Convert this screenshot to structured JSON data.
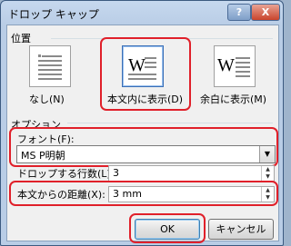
{
  "dialog": {
    "title": "ドロップ キャップ",
    "help": "?",
    "close": "X"
  },
  "position": {
    "label": "位置",
    "options": [
      {
        "caption": "なし(N)",
        "selected": false
      },
      {
        "caption": "本文内に表示(D)",
        "selected": true
      },
      {
        "caption": "余白に表示(M)",
        "selected": false
      }
    ],
    "glyph": "W"
  },
  "options": {
    "label": "オプション",
    "font_label": "フォント(F):",
    "font_value": "MS P明朝",
    "lines_label": "ドロップする行数(L):",
    "lines_value": "3",
    "distance_label": "本文からの距離(X):",
    "distance_value": "3 mm"
  },
  "buttons": {
    "ok": "OK",
    "cancel": "キャンセル"
  },
  "colors": {
    "highlight": "#e0202a",
    "accent": "#3b6fb6"
  }
}
